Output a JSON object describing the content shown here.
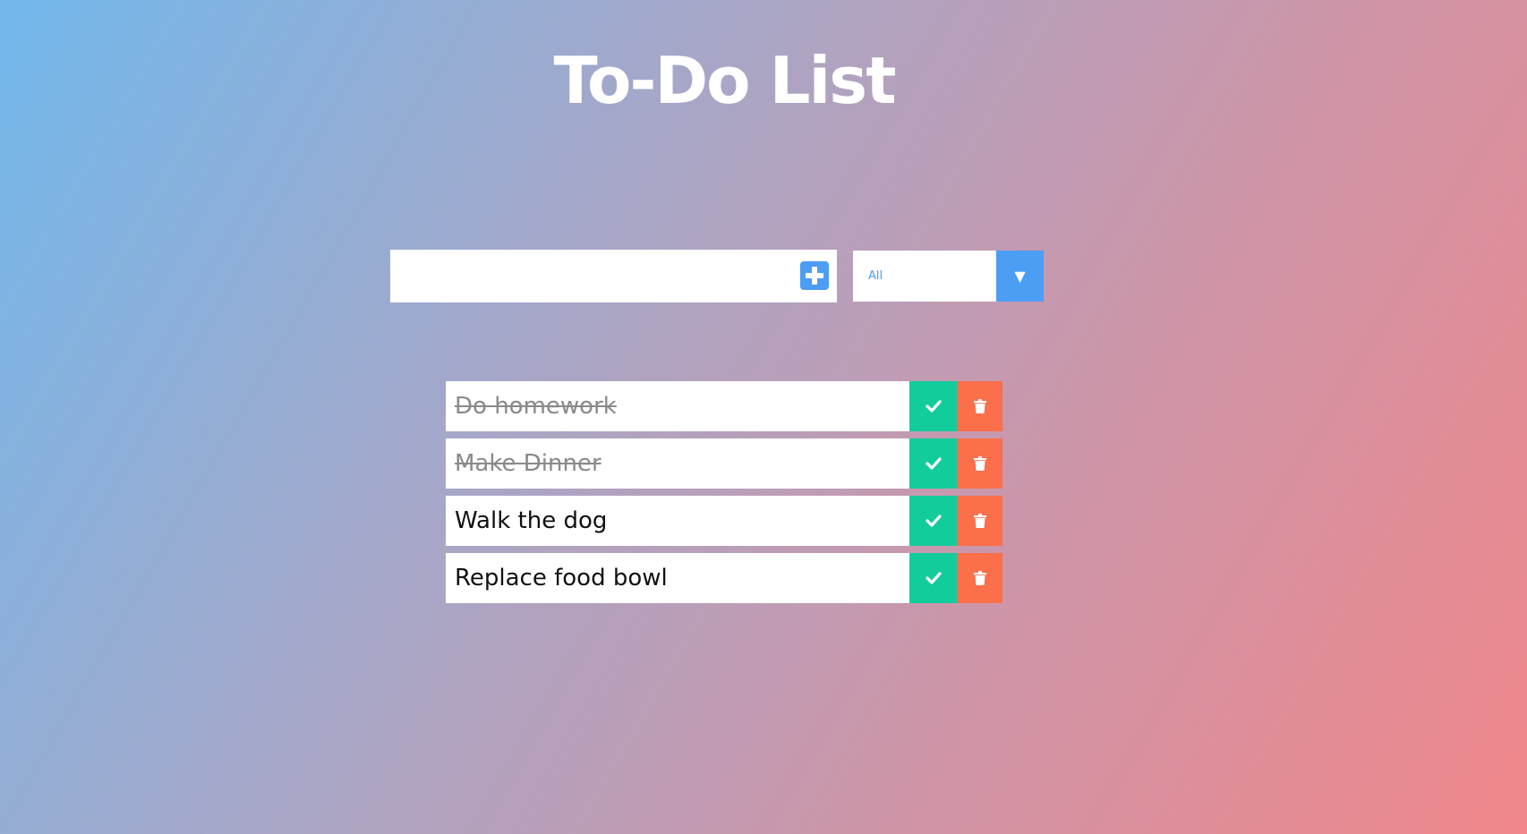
{
  "header": {
    "title": "To-Do List"
  },
  "form": {
    "input_value": "",
    "input_placeholder": "",
    "add_icon": "plus-square-icon"
  },
  "filter": {
    "selected": "All",
    "arrow_glyph": "▼"
  },
  "todos": [
    {
      "text": "Do homework",
      "completed": true
    },
    {
      "text": "Make Dinner",
      "completed": true
    },
    {
      "text": "Walk the dog",
      "completed": false
    },
    {
      "text": "Replace food bowl",
      "completed": false
    }
  ],
  "icons": {
    "complete": "check-icon",
    "delete": "trash-icon"
  },
  "colors": {
    "accent": "#4c9df4",
    "complete": "#12cc9c",
    "delete": "#fb6f4b",
    "gradient_start": "#72b8ec",
    "gradient_end": "#f0868a"
  }
}
